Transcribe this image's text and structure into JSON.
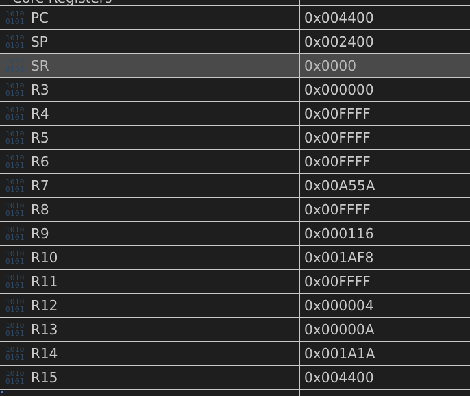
{
  "group": {
    "title": "Core Registers",
    "chevron_icon": "chevron-down-icon"
  },
  "register_icon": {
    "name": "binary-icon",
    "top": "1010",
    "bottom": "0101"
  },
  "registers": [
    {
      "name": "PC",
      "value": "0x004400",
      "selected": false
    },
    {
      "name": "SP",
      "value": "0x002400",
      "selected": false
    },
    {
      "name": "SR",
      "value": "0x0000",
      "selected": true
    },
    {
      "name": "R3",
      "value": "0x000000",
      "selected": false
    },
    {
      "name": "R4",
      "value": "0x00FFFF",
      "selected": false
    },
    {
      "name": "R5",
      "value": "0x00FFFF",
      "selected": false
    },
    {
      "name": "R6",
      "value": "0x00FFFF",
      "selected": false
    },
    {
      "name": "R7",
      "value": "0x00A55A",
      "selected": false
    },
    {
      "name": "R8",
      "value": "0x00FFFF",
      "selected": false
    },
    {
      "name": "R9",
      "value": "0x000116",
      "selected": false
    },
    {
      "name": "R10",
      "value": "0x001AF8",
      "selected": false
    },
    {
      "name": "R11",
      "value": "0x00FFFF",
      "selected": false
    },
    {
      "name": "R12",
      "value": "0x000004",
      "selected": false
    },
    {
      "name": "R13",
      "value": "0x00000A",
      "selected": false
    },
    {
      "name": "R14",
      "value": "0x001A1A",
      "selected": false
    },
    {
      "name": "R15",
      "value": "0x004400",
      "selected": false
    }
  ],
  "colors": {
    "background": "#1e1e1e",
    "selected_row": "#4a4a4a",
    "grid_line": "#c8c8c8",
    "text": "#c9c9c9",
    "icon": "#2d4a66"
  }
}
